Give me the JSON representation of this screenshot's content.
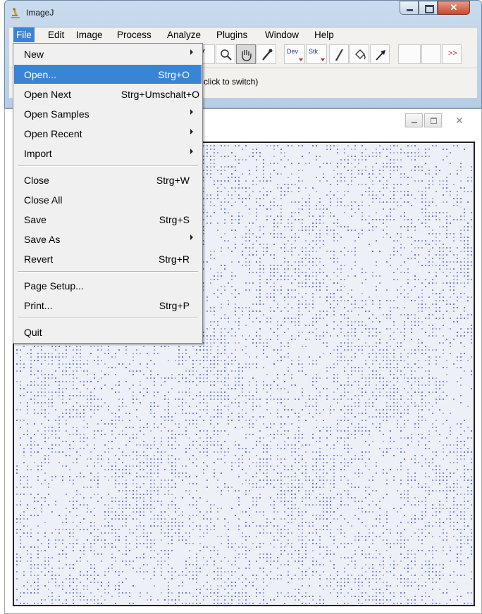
{
  "app": {
    "title": "ImageJ"
  },
  "menubar": [
    {
      "label": "File",
      "active": true
    },
    {
      "label": "Edit"
    },
    {
      "label": "Image"
    },
    {
      "label": "Process"
    },
    {
      "label": "Analyze"
    },
    {
      "label": "Plugins"
    },
    {
      "label": "Window"
    },
    {
      "label": "Help"
    }
  ],
  "toolbar": {
    "dev_label": "Dev",
    "stk_label": "Stk",
    "more_label": ">>",
    "tools": [
      "line-tool",
      "magnifier-tool",
      "hand-tool",
      "dropper-tool",
      "dev-tool",
      "stk-tool",
      "brush-tool",
      "fill-tool",
      "arrow-tool"
    ]
  },
  "status": {
    "text": "click to switch)"
  },
  "file_menu": {
    "items": [
      {
        "label": "New",
        "submenu": true
      },
      {
        "label": "Open...",
        "shortcut": "Strg+O",
        "highlighted": true
      },
      {
        "label": "Open Next",
        "shortcut": "Strg+Umschalt+O"
      },
      {
        "label": "Open Samples",
        "submenu": true
      },
      {
        "label": "Open Recent",
        "submenu": true
      },
      {
        "label": "Import",
        "submenu": true
      },
      {
        "label": "Close",
        "shortcut": "Strg+W"
      },
      {
        "label": "Close All"
      },
      {
        "label": "Save",
        "shortcut": "Strg+S"
      },
      {
        "label": "Save As",
        "submenu": true
      },
      {
        "label": "Revert",
        "shortcut": "Strg+R"
      },
      {
        "label": "Page Setup..."
      },
      {
        "label": "Print...",
        "shortcut": "Strg+P"
      },
      {
        "label": "Quit"
      }
    ]
  },
  "colors": {
    "highlight": "#3a84d6",
    "dot_color": "#5d73c9",
    "canvas_bg": "#eef0f8"
  },
  "icons": {
    "app": "imagej-microscope-icon",
    "minimize": "minimize-icon",
    "maximize": "maximize-icon",
    "close": "close-icon",
    "submenu": "submenu-arrow-icon"
  }
}
